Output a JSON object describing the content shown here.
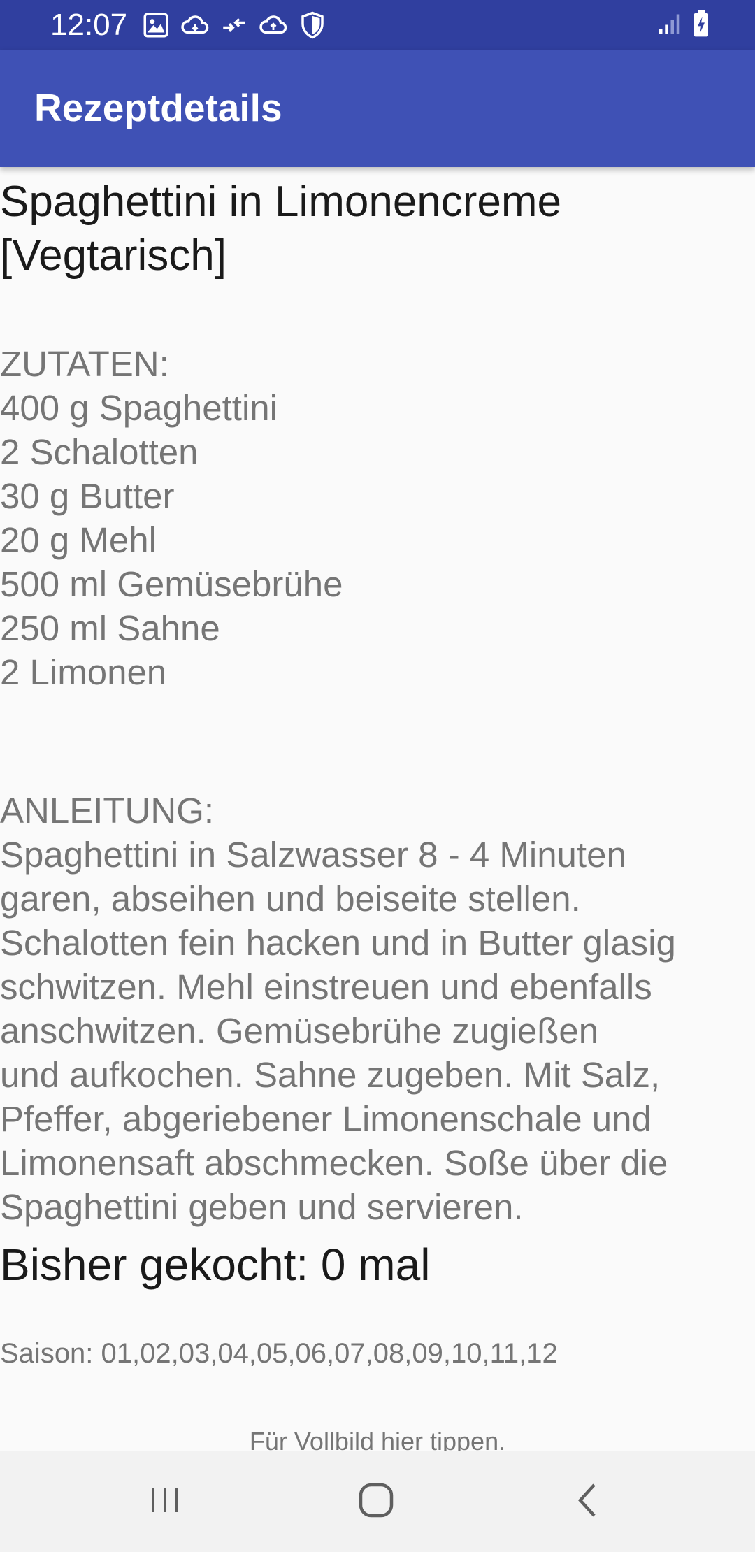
{
  "status_bar": {
    "time": "12:07",
    "icons_left": [
      "image-icon",
      "cloud-sync-icon",
      "data-transfer-icon",
      "cloud-sync-icon",
      "shield-icon"
    ],
    "icons_right": [
      "signal-icon",
      "battery-charging-icon"
    ],
    "bg_color": "#303f9f"
  },
  "app_bar": {
    "title": "Rezeptdetails",
    "bg_color": "#3f51b5"
  },
  "recipe": {
    "title_lines": [
      "Spaghettini in Limonencreme",
      "[Vegtarisch]"
    ],
    "ingredients_heading": "ZUTATEN:",
    "ingredients": [
      "400 g Spaghettini",
      "2 Schalotten",
      "30 g Butter",
      "20 g Mehl",
      "500 ml Gemüsebrühe",
      "250 ml Sahne",
      "2 Limonen"
    ],
    "instructions_heading": "ANLEITUNG:",
    "instructions_lines": [
      "Spaghettini in Salzwasser 8 - 4 Minuten",
      "garen, abseihen und beiseite stellen.",
      "Schalotten fein hacken und in Butter glasig",
      "schwitzen. Mehl einstreuen und ebenfalls",
      "anschwitzen. Gemüsebrühe zugießen",
      "und aufkochen. Sahne zugeben. Mit Salz,",
      "Pfeffer, abgeriebener Limonenschale und",
      "Limonensaft abschmecken. Soße über die",
      "Spaghettini geben und servieren."
    ],
    "cooked_count": "Bisher gekocht: 0 mal",
    "season": "Saison: 01,02,03,04,05,06,07,08,09,10,11,12",
    "fullscreen_hint": "Für Vollbild hier tippen."
  },
  "nav_bar": {
    "buttons": [
      "recent-apps-icon",
      "home-icon",
      "back-icon"
    ]
  }
}
